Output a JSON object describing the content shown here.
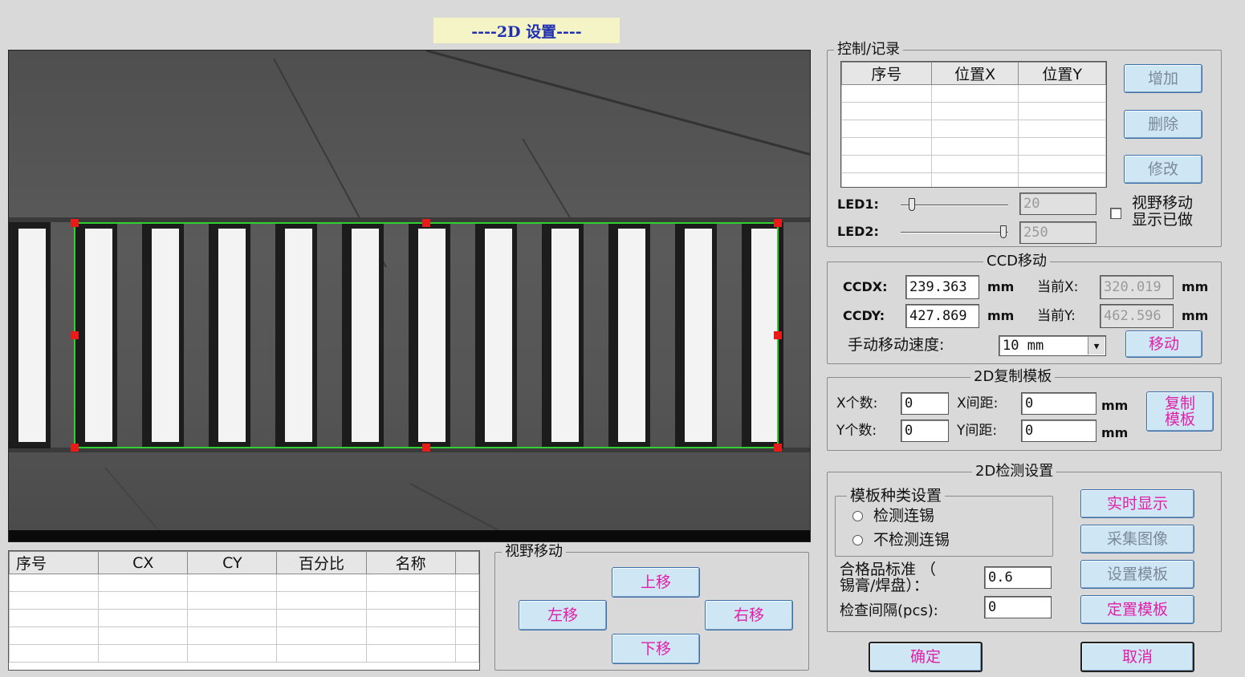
{
  "window_title": "----2D 设置----",
  "colors": {
    "button_bg": "#cfe6f5",
    "pink_text": "#e020a8",
    "blue_text": "#1f5fc9",
    "roi_green": "#2fd02f",
    "roi_handle": "#e81b1b"
  },
  "control_record": {
    "legend": "控制/记录",
    "columns": [
      "序号",
      "位置X",
      "位置Y"
    ],
    "buttons": {
      "add": "增加",
      "delete": "删除",
      "modify": "修改"
    },
    "led1": {
      "label": "LED1:",
      "value": "20",
      "level": 20
    },
    "led2": {
      "label": "LED2:",
      "value": "250",
      "level": 250
    },
    "led_range": [
      0,
      255
    ],
    "view_move_checkbox": {
      "line1": "视野移动",
      "line2": "显示已做",
      "checked": false
    }
  },
  "ccd_move": {
    "legend": "CCD移动",
    "ccdx_label": "CCDX:",
    "ccdx_value": "239.363",
    "ccdy_label": "CCDY:",
    "ccdy_value": "427.869",
    "unit": "mm",
    "current_x_label": "当前X:",
    "current_x_value": "320.019",
    "current_y_label": "当前Y:",
    "current_y_value": "462.596",
    "speed_label": "手动移动速度:",
    "speed_value": "10 mm",
    "move_button": "移动"
  },
  "copy_template": {
    "legend": "2D复制模板",
    "x_count_label": "X个数:",
    "x_count_value": "0",
    "y_count_label": "Y个数:",
    "y_count_value": "0",
    "x_pitch_label": "X间距:",
    "x_pitch_value": "0",
    "y_pitch_label": "Y间距:",
    "y_pitch_value": "0",
    "unit": "mm",
    "copy_button_line1": "复制",
    "copy_button_line2": "模板"
  },
  "detect_settings": {
    "legend": "2D检测设置",
    "template_type_legend": "模板种类设置",
    "radio_detect_bridge": "检测连锡",
    "radio_no_detect_bridge": "不检测连锡",
    "qualify_label_line1": "合格品标准 （",
    "qualify_label_line2": "锡膏/焊盘）：",
    "qualify_value": "0.6",
    "interval_label": "检查间隔(pcs):",
    "interval_value": "0",
    "buttons": {
      "realtime": "实时显示",
      "capture": "采集图像",
      "set_template": "设置模板",
      "fix_template": "定置模板"
    }
  },
  "result_table": {
    "columns": [
      "序号",
      "CX",
      "CY",
      "百分比",
      "名称"
    ]
  },
  "view_move": {
    "legend": "视野移动",
    "up": "上移",
    "down": "下移",
    "left": "左移",
    "right": "右移"
  },
  "footer": {
    "ok": "确定",
    "cancel": "取消"
  }
}
